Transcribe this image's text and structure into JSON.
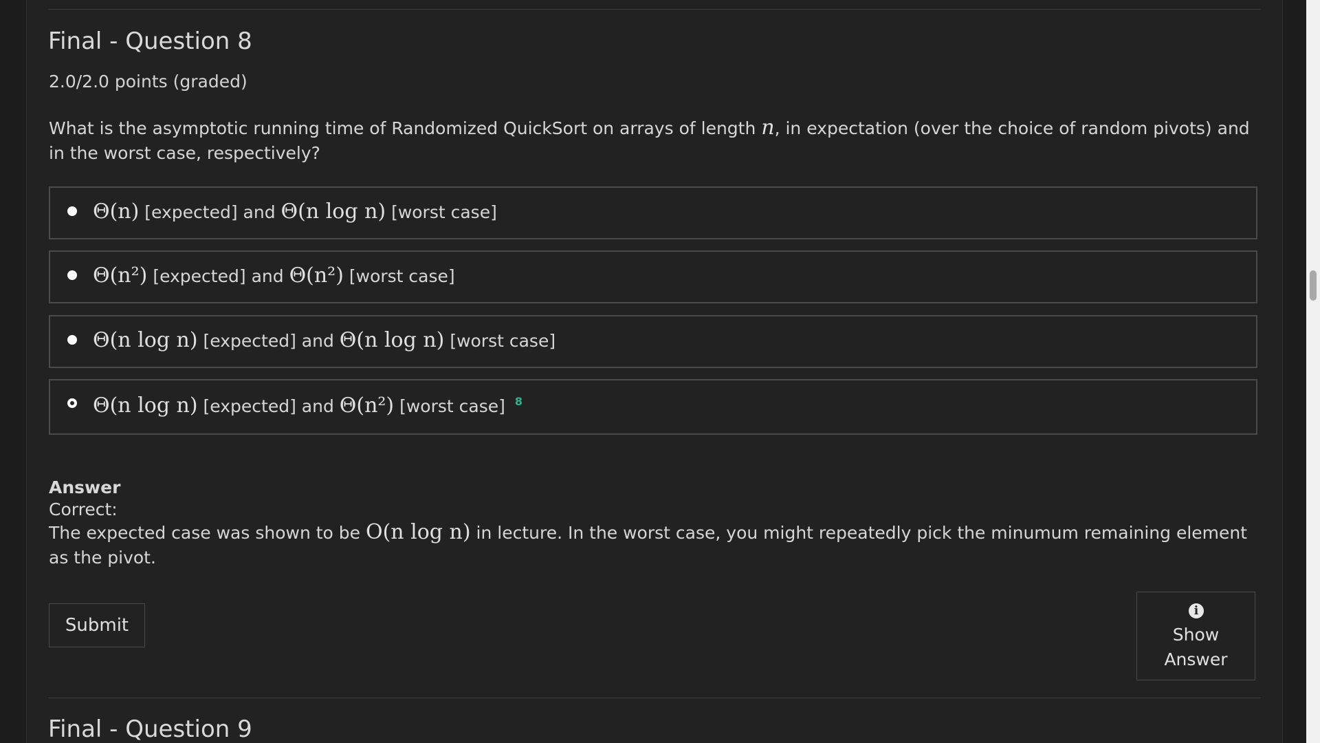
{
  "question8": {
    "title": "Final - Question 8",
    "points": "2.0/2.0 points (graded)",
    "prompt_before": "What is the asymptotic running time of Randomized QuickSort on arrays of length",
    "prompt_var": "n",
    "prompt_after": ", in expectation (over the choice of random pivots) and in the worst case, respectively?",
    "options": [
      {
        "expected_math": "Θ(n)",
        "worst_math": "Θ(n log n)",
        "selected": false
      },
      {
        "expected_math": "Θ(n²)",
        "worst_math": "Θ(n²)",
        "selected": false
      },
      {
        "expected_math": "Θ(n log n)",
        "worst_math": "Θ(n log n)",
        "selected": false
      },
      {
        "expected_math": "Θ(n log n)",
        "worst_math": "Θ(n²)",
        "selected": true,
        "mark": "8"
      }
    ],
    "expected_label": "[expected]",
    "and_label": "and",
    "worst_label": "[worst case]",
    "answer": {
      "heading": "Answer",
      "status": "Correct:",
      "explanation_before": "The expected case was shown to be",
      "explanation_math": "O(n log n)",
      "explanation_after": "in lecture. In the worst case, you might repeatedly pick the minumum remaining element as the pivot."
    },
    "submit_label": "Submit",
    "show_answer_label_1": "Show",
    "show_answer_label_2": "Answer",
    "info_icon_glyph": "i"
  },
  "question9": {
    "title": "Final - Question 9"
  },
  "colors": {
    "background": "#222222",
    "correct_accent": "#2fb38f",
    "border": "#4a4a4a"
  }
}
